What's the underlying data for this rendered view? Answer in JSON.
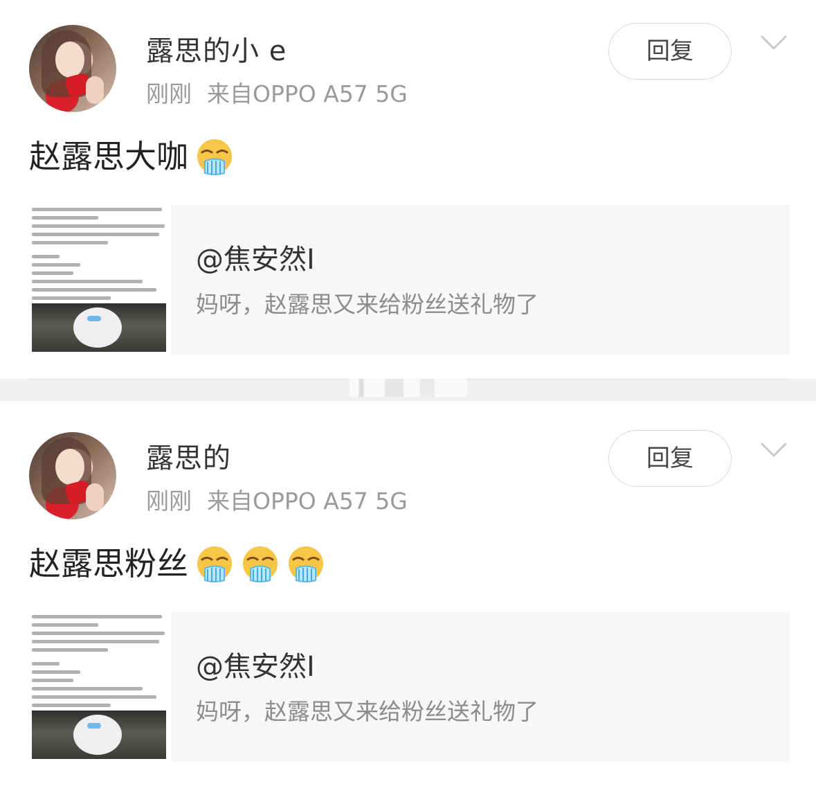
{
  "comments": [
    {
      "username": "露思的小    e",
      "time": "刚刚",
      "source": "来自OPPO A57 5G",
      "reply_label": "回复",
      "text": "赵露思大咖",
      "emoji_icons": [
        "drooling-face-icon"
      ],
      "share": {
        "title": "@焦安然I",
        "description": "妈呀，赵露思又来给粉丝送礼物了"
      }
    },
    {
      "username": "露思的",
      "time": "刚刚",
      "source": "来自OPPO A57 5G",
      "reply_label": "回复",
      "text": "赵露思粉丝",
      "emoji_icons": [
        "drooling-face-icon",
        "drooling-face-icon",
        "drooling-face-icon"
      ],
      "share": {
        "title": "@焦安然I",
        "description": "妈呀，赵露思又来给粉丝送礼物了"
      }
    }
  ],
  "colors": {
    "reply_border": "#d8d8d8",
    "meta_text": "#9a9a9a",
    "share_background": "#f7f7f7"
  }
}
